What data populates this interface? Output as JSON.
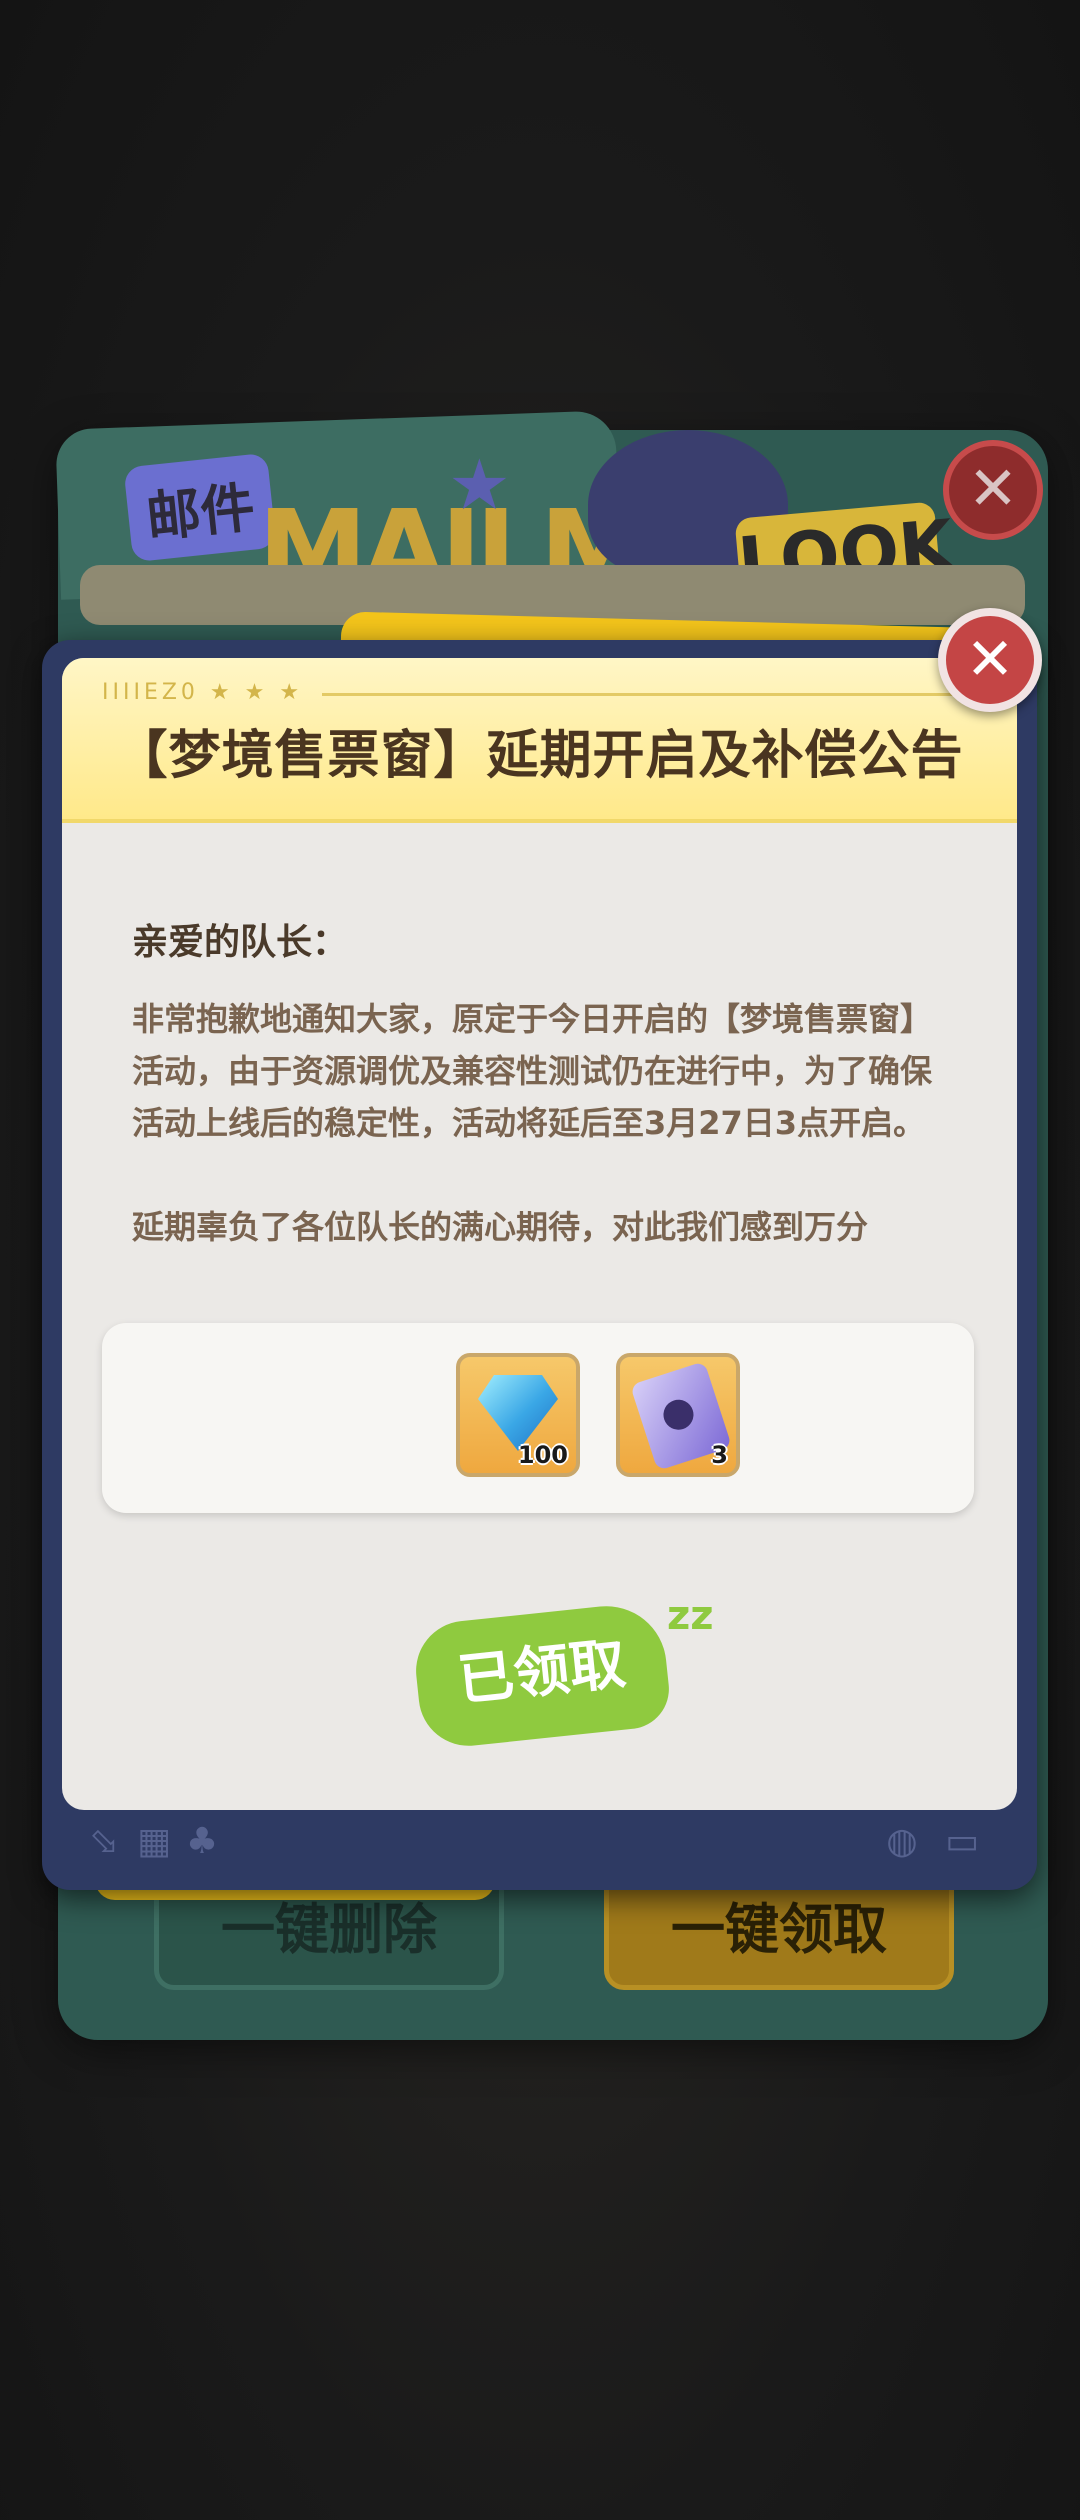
{
  "background_window": {
    "title": "邮件",
    "banner_text": "MAILMA",
    "badge_text": "LOOK",
    "close_glyph": "✕",
    "delete_all_label": "一键删除",
    "claim_all_label": "一键领取"
  },
  "notice": {
    "header_deco": "IIIIEZ0 ★ ★ ★",
    "title": "【梦境售票窗】延期开启及补偿公告",
    "greeting": "亲爱的队长：",
    "paragraphs": [
      "非常抱歉地通知大家，原定于今日开启的【梦境售票窗】活动，由于资源调优及兼容性测试仍在进行中，为了确保活动上线后的稳定性，活动将延后至3月27日3点开启。",
      "延期辜负了各位队长的满心期待，对此我们感到万分"
    ],
    "rewards": [
      {
        "icon": "blue-gem-icon",
        "count": "100"
      },
      {
        "icon": "ticket-icon",
        "count": "3"
      }
    ],
    "claimed_label": "已领取",
    "claimed_suffix": "zz",
    "close_glyph": "✕"
  },
  "footer_icons": [
    "arrow-corner-icon",
    "grid-icon",
    "club-icon",
    "globe-icon",
    "panel-icon"
  ],
  "colors": {
    "accent_yellow": "#f4c51b",
    "frame_navy": "#2e3a63",
    "close_red": "#c44545",
    "claimed_green": "#8fca3f"
  }
}
